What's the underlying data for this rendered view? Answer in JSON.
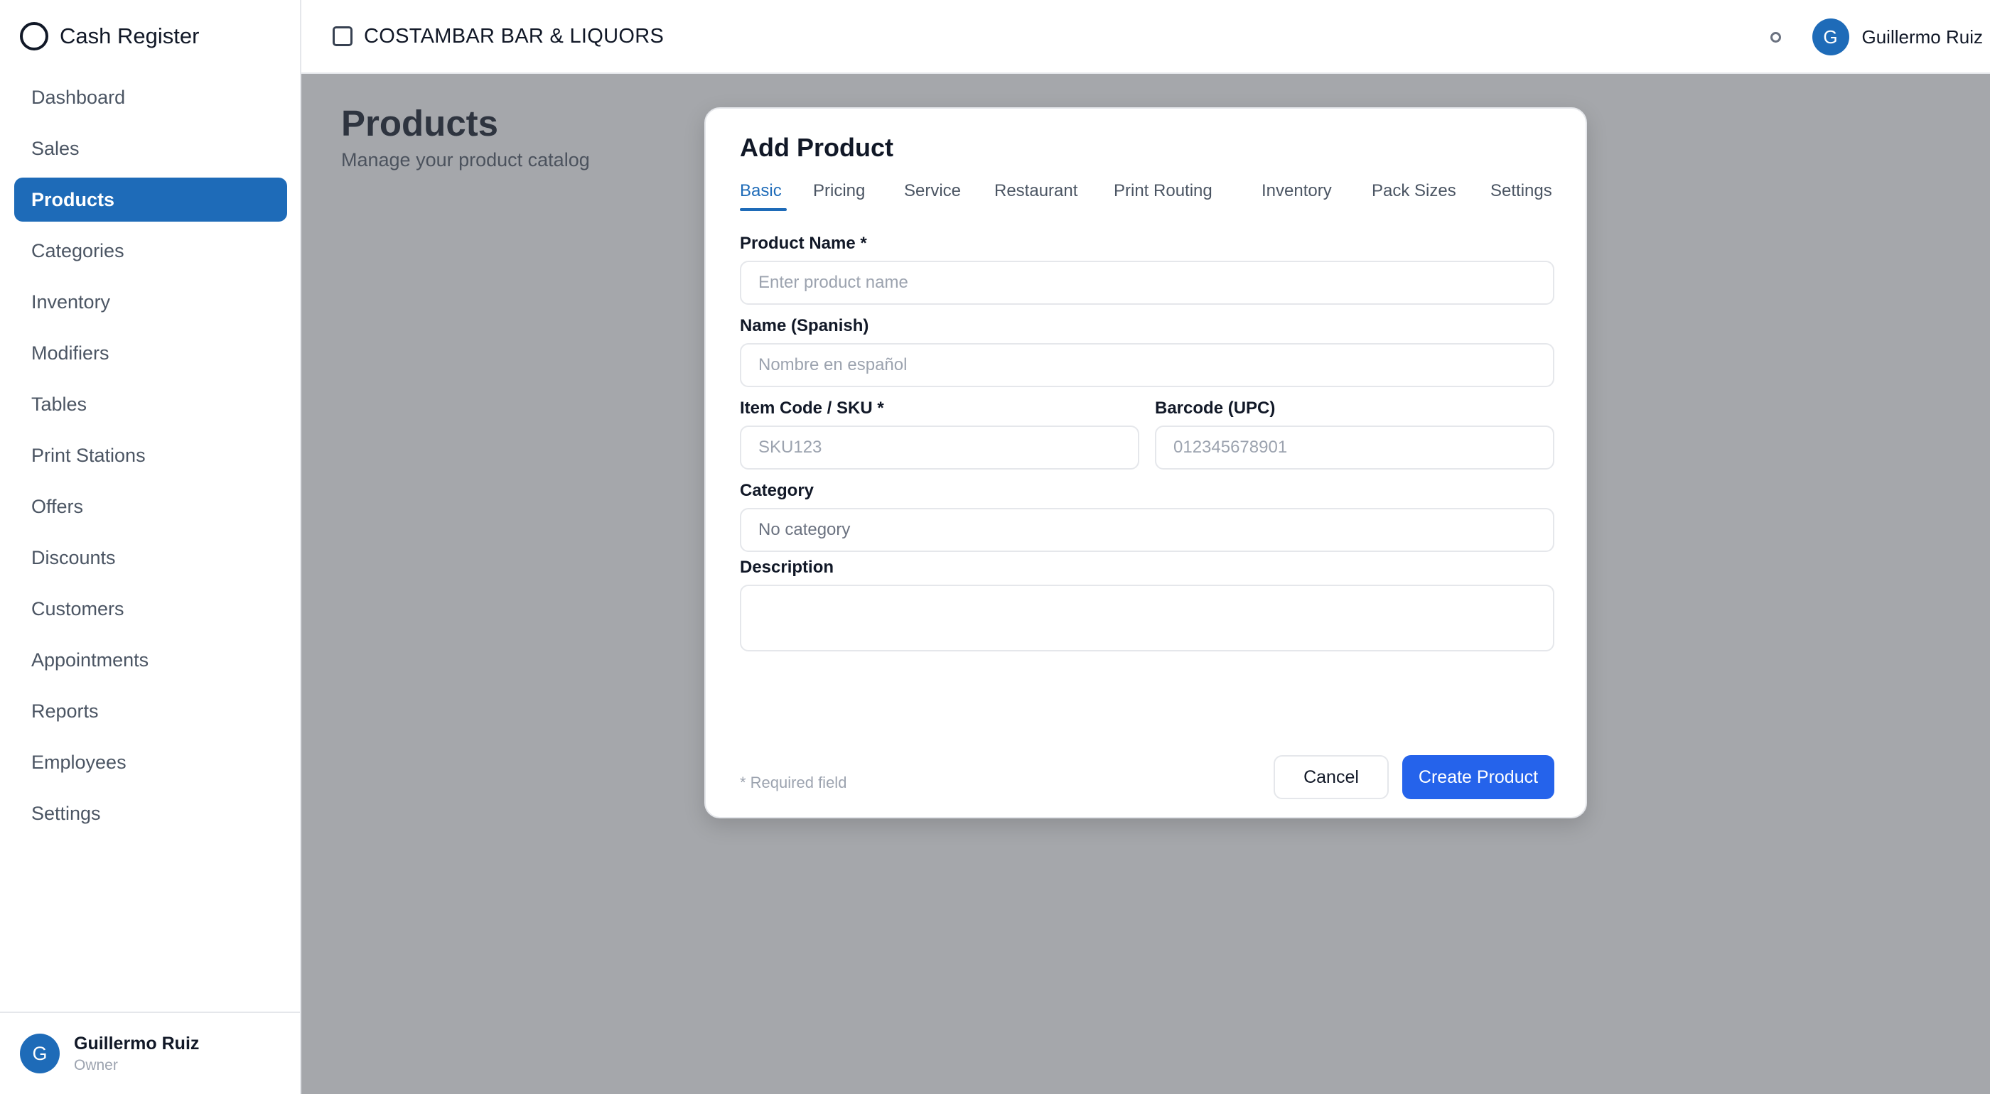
{
  "app": {
    "title": "Cash Register"
  },
  "sidebar": {
    "items": [
      {
        "label": "Dashboard"
      },
      {
        "label": "Sales"
      },
      {
        "label": "Products",
        "active": true
      },
      {
        "label": "Categories"
      },
      {
        "label": "Inventory"
      },
      {
        "label": "Modifiers"
      },
      {
        "label": "Tables"
      },
      {
        "label": "Print Stations"
      },
      {
        "label": "Offers"
      },
      {
        "label": "Discounts"
      },
      {
        "label": "Customers"
      },
      {
        "label": "Appointments"
      },
      {
        "label": "Reports"
      },
      {
        "label": "Employees"
      },
      {
        "label": "Settings"
      }
    ],
    "user": {
      "initial": "G",
      "name": "Guillermo Ruiz",
      "role": "Owner"
    }
  },
  "header": {
    "store_name": "COSTAMBAR BAR & LIQUORS",
    "user": {
      "initial": "G",
      "name": "Guillermo Ruiz"
    }
  },
  "page": {
    "title": "Products",
    "subtitle": "Manage your product catalog"
  },
  "modal": {
    "title": "Add Product",
    "tabs": [
      {
        "label": "Basic",
        "active": true
      },
      {
        "label": "Pricing"
      },
      {
        "label": "Service"
      },
      {
        "label": "Restaurant"
      },
      {
        "label": "Print Routing"
      },
      {
        "label": "Inventory"
      },
      {
        "label": "Pack Sizes"
      },
      {
        "label": "Settings"
      }
    ],
    "fields": {
      "product_name": {
        "label": "Product Name *",
        "placeholder": "Enter product name",
        "value": ""
      },
      "name_spanish": {
        "label": "Name (Spanish)",
        "placeholder": "Nombre en español",
        "value": ""
      },
      "sku": {
        "label": "Item Code / SKU *",
        "placeholder": "SKU123",
        "value": ""
      },
      "barcode": {
        "label": "Barcode (UPC)",
        "placeholder": "012345678901",
        "value": ""
      },
      "category": {
        "label": "Category",
        "value": "No category"
      },
      "description": {
        "label": "Description",
        "value": ""
      }
    },
    "required_note": "* Required field",
    "cancel_label": "Cancel",
    "create_label": "Create Product"
  },
  "colors": {
    "accent": "#1e6bb8",
    "primary_button": "#2563eb",
    "overlay": "#a1a1a3"
  }
}
